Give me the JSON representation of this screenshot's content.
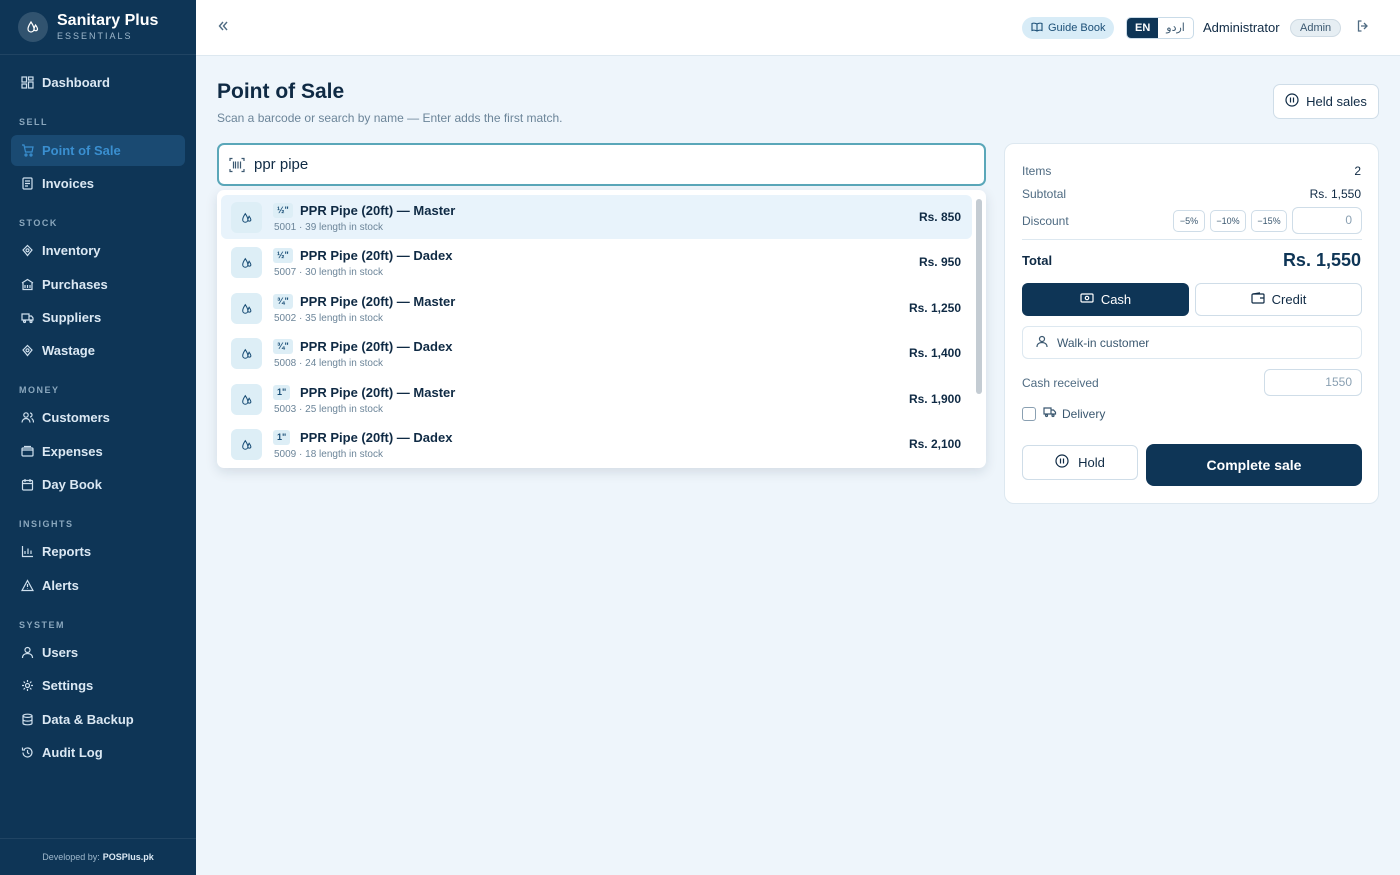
{
  "brand": {
    "name": "Sanitary Plus",
    "tagline": "ESSENTIALS"
  },
  "sidebar": {
    "items": [
      {
        "label": "Dashboard",
        "icon": "dashboard-icon"
      },
      {
        "label": "Point of Sale",
        "icon": "cart-icon",
        "active": true
      },
      {
        "label": "Invoices",
        "icon": "receipt-icon"
      },
      {
        "label": "Inventory",
        "icon": "drop-icon"
      },
      {
        "label": "Purchases",
        "icon": "building-icon"
      },
      {
        "label": "Suppliers",
        "icon": "truck-icon"
      },
      {
        "label": "Wastage",
        "icon": "drop-icon"
      },
      {
        "label": "Customers",
        "icon": "users-icon"
      },
      {
        "label": "Expenses",
        "icon": "wallet-icon"
      },
      {
        "label": "Day Book",
        "icon": "calendar-icon"
      },
      {
        "label": "Reports",
        "icon": "bar-chart-icon"
      },
      {
        "label": "Alerts",
        "icon": "warning-icon"
      },
      {
        "label": "Users",
        "icon": "user-icon"
      },
      {
        "label": "Settings",
        "icon": "gear-icon"
      },
      {
        "label": "Data & Backup",
        "icon": "database-icon"
      },
      {
        "label": "Audit Log",
        "icon": "history-icon"
      }
    ],
    "sections": [
      "SELL",
      "STOCK",
      "MONEY",
      "INSIGHTS",
      "SYSTEM"
    ],
    "developed_by_label": "Developed by:",
    "developed_by": "POSPlus.pk"
  },
  "topbar": {
    "guide_label": "Guide Book",
    "lang_en": "EN",
    "lang_ur": "اردو",
    "user_name": "Administrator",
    "role": "Admin"
  },
  "page": {
    "title": "Point of Sale",
    "subtitle": "Scan a barcode or search by name — Enter adds the first match.",
    "held_label": "Held sales"
  },
  "search": {
    "value": "ppr pipe"
  },
  "results": [
    {
      "size": "½\"",
      "name": "PPR Pipe (20ft) — Master",
      "meta": "5001 · 39 length in stock",
      "price": "Rs. 850"
    },
    {
      "size": "½\"",
      "name": "PPR Pipe (20ft) — Dadex",
      "meta": "5007 · 30 length in stock",
      "price": "Rs. 950"
    },
    {
      "size": "¾\"",
      "name": "PPR Pipe (20ft) — Master",
      "meta": "5002 · 35 length in stock",
      "price": "Rs. 1,250"
    },
    {
      "size": "¾\"",
      "name": "PPR Pipe (20ft) — Dadex",
      "meta": "5008 · 24 length in stock",
      "price": "Rs. 1,400"
    },
    {
      "size": "1\"",
      "name": "PPR Pipe (20ft) — Master",
      "meta": "5003 · 25 length in stock",
      "price": "Rs. 1,900"
    },
    {
      "size": "1\"",
      "name": "PPR Pipe (20ft) — Dadex",
      "meta": "5009 · 18 length in stock",
      "price": "Rs. 2,100"
    }
  ],
  "cart": {
    "items_label": "Items",
    "items_value": "2",
    "subtotal_label": "Subtotal",
    "subtotal_value": "Rs. 1,550",
    "discount_label": "Discount",
    "discount_presets": [
      "−5%",
      "−10%",
      "−15%"
    ],
    "discount_placeholder": "0",
    "total_label": "Total",
    "total_value": "Rs. 1,550",
    "cash_label": "Cash",
    "credit_label": "Credit",
    "customer_label": "Walk-in customer",
    "cash_received_label": "Cash received",
    "cash_received_placeholder": "1550",
    "delivery_label": "Delivery",
    "hold_label": "Hold",
    "complete_label": "Complete sale"
  },
  "colors": {
    "sidebar": "#0e3556",
    "accent": "#0e3556",
    "highlight": "#e8f3fb"
  }
}
